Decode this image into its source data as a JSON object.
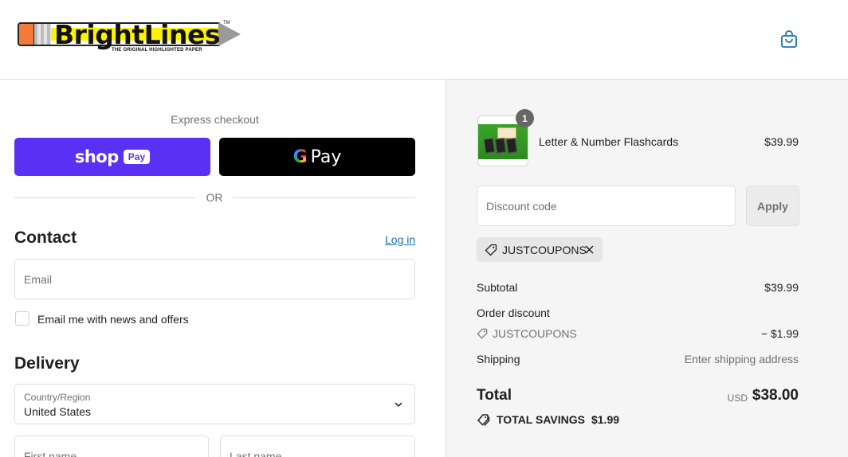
{
  "header": {
    "brand": "BrightLines",
    "tagline": "THE ORIGINAL HIGHLIGHTED PAPER",
    "trademark": "TM",
    "cart_icon": "shopping-bag-icon"
  },
  "express": {
    "label": "Express checkout",
    "shop_word": "shop",
    "shop_badge": "Pay",
    "gpay_g": "G",
    "gpay_word": "Pay",
    "divider": "OR"
  },
  "contact": {
    "heading": "Contact",
    "login_link": "Log in",
    "email_placeholder": "Email",
    "newsletter_label": "Email me with news and offers"
  },
  "delivery": {
    "heading": "Delivery",
    "country_label": "Country/Region",
    "country_value": "United States",
    "first_name_placeholder": "First name",
    "last_name_placeholder": "Last name"
  },
  "summary": {
    "item": {
      "quantity": "1",
      "name": "Letter & Number Flashcards",
      "price": "$39.99"
    },
    "discount_placeholder": "Discount code",
    "apply_label": "Apply",
    "coupon": "JUSTCOUPONS",
    "subtotal_label": "Subtotal",
    "subtotal_value": "$39.99",
    "order_discount_label": "Order discount",
    "order_discount_code": "JUSTCOUPONS",
    "order_discount_value": "− $1.99",
    "shipping_label": "Shipping",
    "shipping_value": "Enter shipping address",
    "total_label": "Total",
    "total_currency": "USD",
    "total_value": "$38.00",
    "savings_label": "TOTAL SAVINGS",
    "savings_value": "$1.99"
  },
  "colors": {
    "shop_pay": "#5a31f4",
    "link": "#1773b0",
    "summary_bg": "#f5f5f5"
  }
}
